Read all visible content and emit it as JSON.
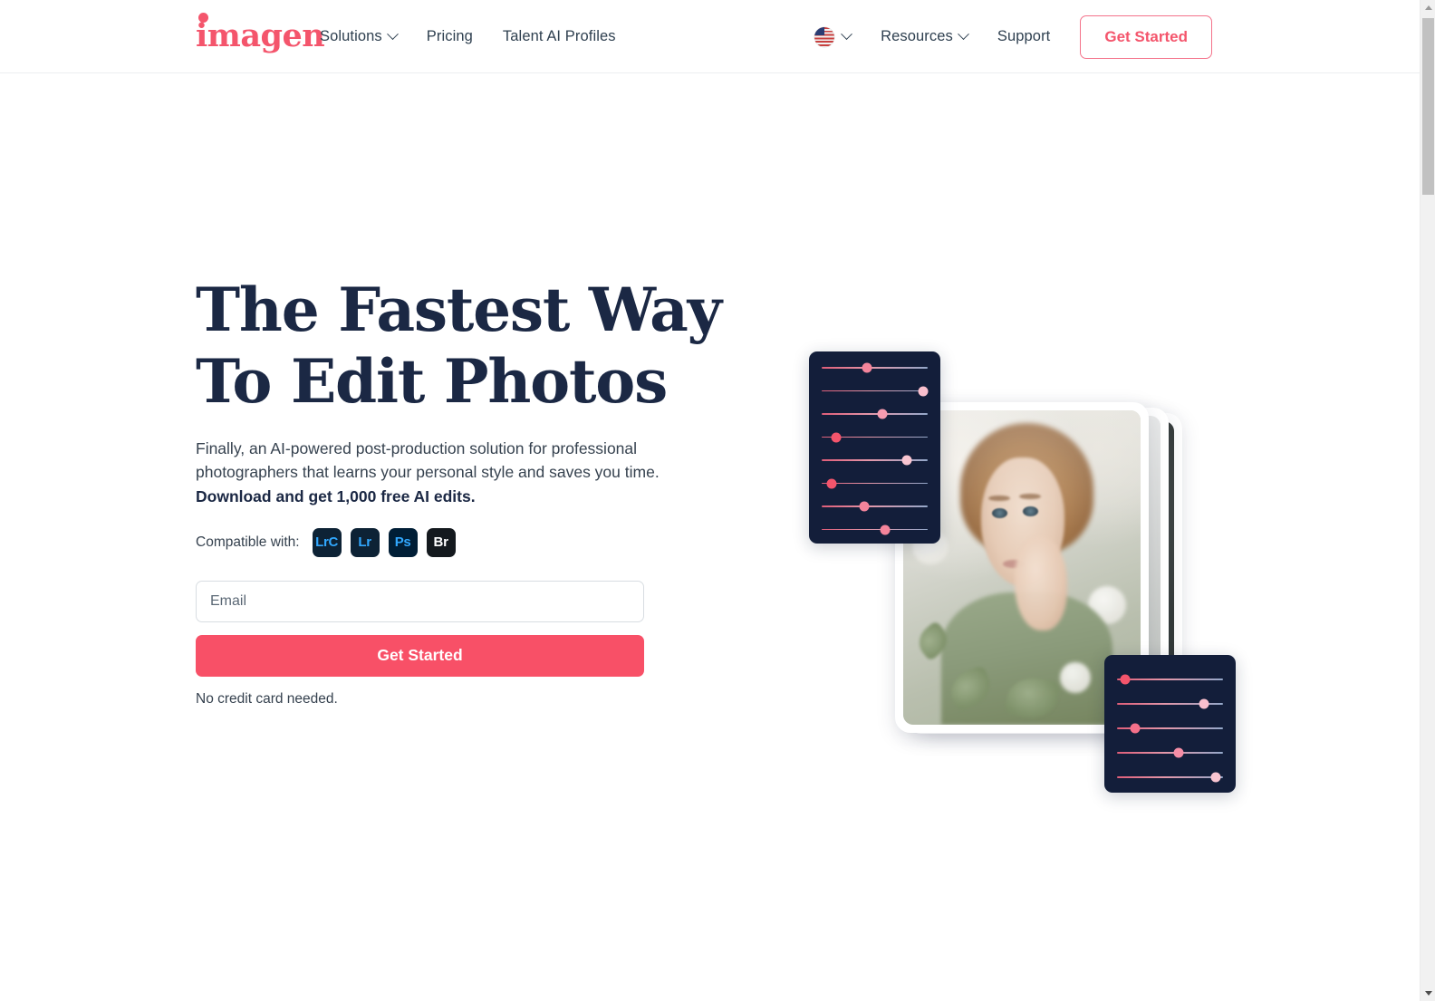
{
  "brand": {
    "name": "imagen",
    "accent_color": "#f4556c",
    "dark_color": "#1b2844",
    "panel_color": "#131e3a",
    "cta_color": "#f85067"
  },
  "nav": {
    "left_items": [
      {
        "label": "Solutions",
        "has_dropdown": true
      },
      {
        "label": "Pricing",
        "has_dropdown": false
      },
      {
        "label": "Talent AI Profiles",
        "has_dropdown": false
      }
    ],
    "language": {
      "icon": "us-flag-icon",
      "has_dropdown": true
    },
    "right_items": [
      {
        "label": "Resources",
        "has_dropdown": true
      },
      {
        "label": "Support",
        "has_dropdown": false
      }
    ],
    "cta_label": "Get Started"
  },
  "hero": {
    "headline": "The Fastest Way\nTo Edit Photos",
    "subhead_normal": "Finally, an AI-powered post-production solution for professional photographers that learns your personal style and saves you time. ",
    "subhead_bold": "Download and get 1,000 free AI edits.",
    "compatible_label": "Compatible with:",
    "compatible_apps": [
      {
        "label": "LrC",
        "bg": "#0d2235",
        "fg": "#31a8ff"
      },
      {
        "label": "Lr",
        "bg": "#0d2235",
        "fg": "#31a8ff"
      },
      {
        "label": "Ps",
        "bg": "#001e36",
        "fg": "#31a8ff"
      },
      {
        "label": "Br",
        "bg": "#14191e",
        "fg": "#ffffff"
      }
    ],
    "email_placeholder": "Email",
    "email_value": "",
    "submit_label": "Get Started",
    "fineprint": "No credit card needed."
  },
  "art": {
    "panel_top_sliders": [
      {
        "value": 43,
        "color": "#f4849b"
      },
      {
        "value": 96,
        "color": "#f9bfcd"
      },
      {
        "value": 57,
        "color": "#f79cb0"
      },
      {
        "value": 14,
        "color": "#f4556c"
      },
      {
        "value": 80,
        "color": "#f9c5d1"
      },
      {
        "value": 9,
        "color": "#f4556c"
      },
      {
        "value": 40,
        "color": "#f4849b"
      },
      {
        "value": 60,
        "color": "#f4849b"
      }
    ],
    "panel_bottom_sliders": [
      {
        "value": 8,
        "color": "#f4556c"
      },
      {
        "value": 82,
        "color": "#f9bfcd"
      },
      {
        "value": 17,
        "color": "#f4708a"
      },
      {
        "value": 58,
        "color": "#f68ea6"
      },
      {
        "value": 93,
        "color": "#f9c5d1"
      }
    ],
    "photo_alt": "portrait-photo-stack"
  },
  "scrollbar": {
    "up_arrow": "scroll-up-arrow",
    "down_arrow": "scroll-down-arrow"
  }
}
